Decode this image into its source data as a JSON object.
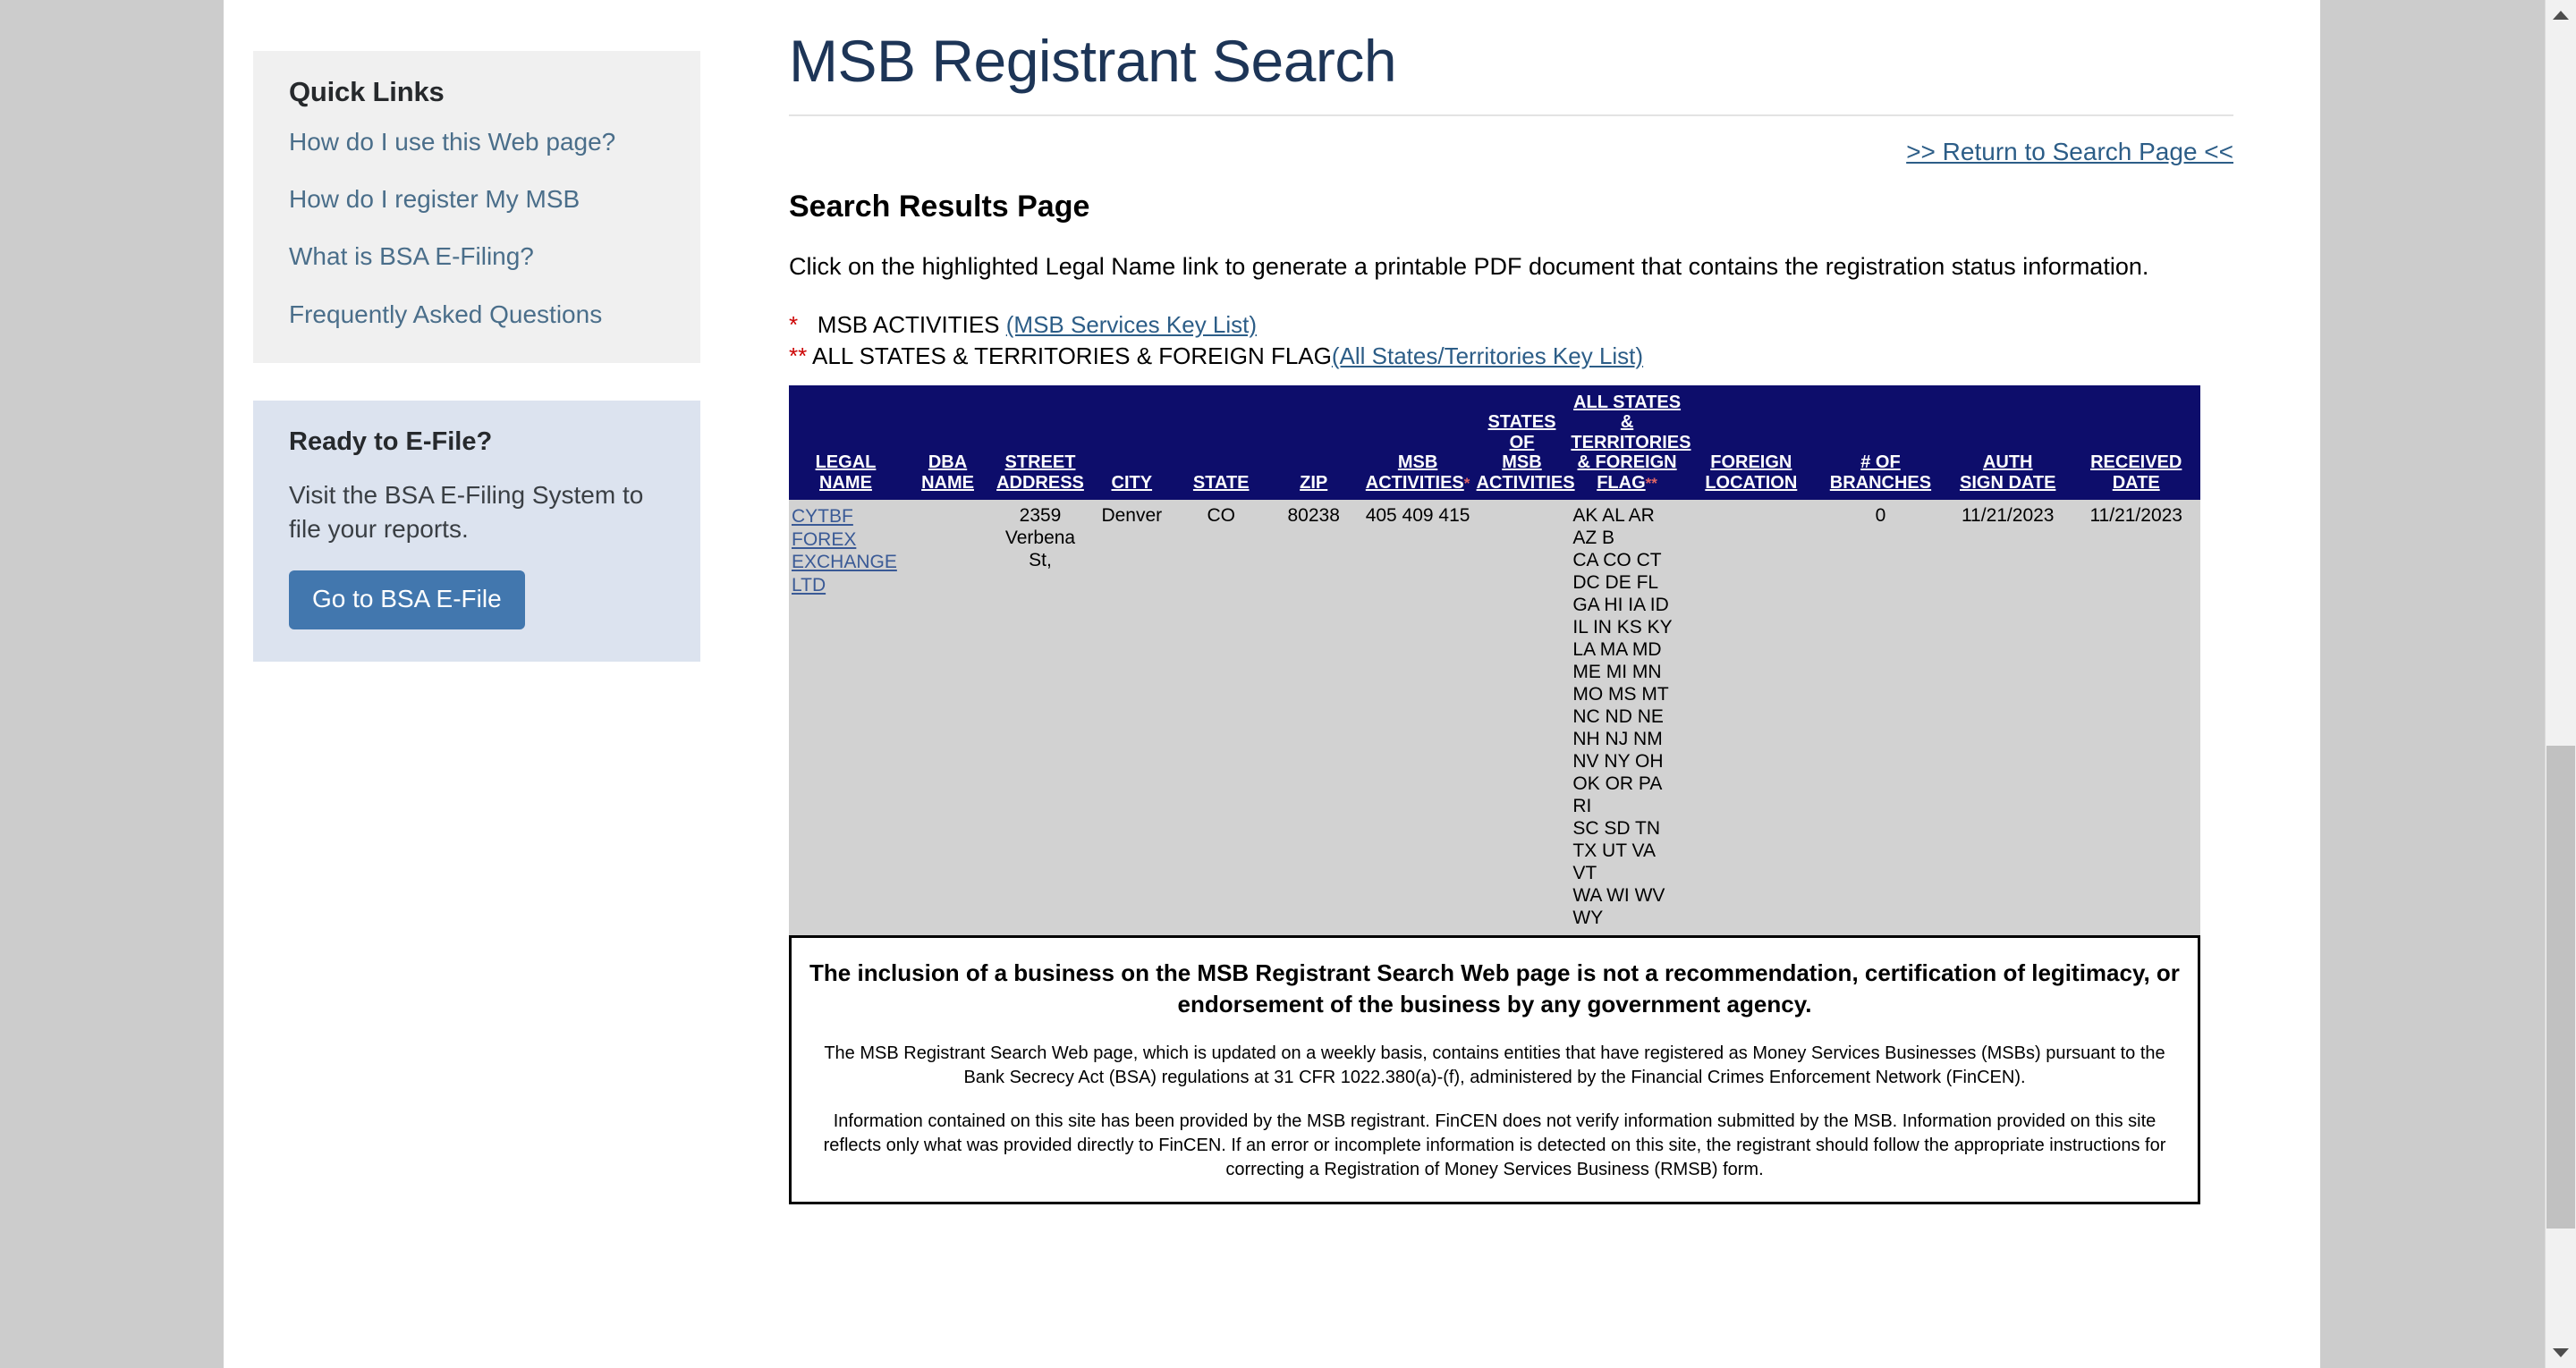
{
  "page": {
    "title": "MSB Registrant Search",
    "return_link": ">> Return to Search Page <<",
    "results_heading": "Search Results Page",
    "click_note": "Click on the highlighted Legal Name link to generate a printable PDF document that contains the registration status information.",
    "legend": {
      "single_star": "*",
      "double_star": "**",
      "msb_activities_label": "MSB ACTIVITIES",
      "msb_activities_link": "(MSB Services Key List)",
      "all_states_label": "ALL STATES & TERRITORIES & FOREIGN FLAG",
      "all_states_link": "(All States/Territories Key List)"
    }
  },
  "sidebar": {
    "quick_links": {
      "title": "Quick Links",
      "items": [
        {
          "label": "How do I use this Web page?"
        },
        {
          "label": "How do I register My MSB"
        },
        {
          "label": "What is BSA E-Filing?"
        },
        {
          "label": "Frequently Asked Questions"
        }
      ]
    },
    "efile": {
      "title": "Ready to E-File?",
      "text": "Visit the BSA E-Filing System to file your reports.",
      "button_label": "Go to BSA E-File"
    }
  },
  "table": {
    "columns": [
      {
        "key": "legal_name",
        "line1": "",
        "line2": "",
        "line3": "LEGAL NAME"
      },
      {
        "key": "dba_name",
        "line1": "",
        "line2": "",
        "line3": "DBA NAME"
      },
      {
        "key": "street",
        "line1": "",
        "line2": "STREET",
        "line3": "ADDRESS"
      },
      {
        "key": "city",
        "line1": "",
        "line2": "",
        "line3": "CITY"
      },
      {
        "key": "state",
        "line1": "",
        "line2": "",
        "line3": "STATE"
      },
      {
        "key": "zip",
        "line1": "",
        "line2": "",
        "line3": "ZIP"
      },
      {
        "key": "msb_act",
        "line1": "",
        "line2": "MSB",
        "line3": "ACTIVITIES",
        "star": "*"
      },
      {
        "key": "states_msb",
        "line1": "",
        "line2": "STATES OF",
        "line2b": "MSB",
        "line3": "ACTIVITIES"
      },
      {
        "key": "all_states",
        "line0": "ALL STATES",
        "line0b": "&",
        "line1": "TERRITORIES",
        "line2": "& FOREIGN",
        "line3": "FLAG",
        "star": "**"
      },
      {
        "key": "foreign_loc",
        "line1": "",
        "line2": "FOREIGN",
        "line3": "LOCATION"
      },
      {
        "key": "branches",
        "line1": "",
        "line2": "# OF",
        "line3": "BRANCHES"
      },
      {
        "key": "auth_sign",
        "line1": "",
        "line2": "AUTH",
        "line3": "SIGN DATE"
      },
      {
        "key": "received",
        "line1": "",
        "line2": "RECEIVED",
        "line3": "DATE"
      }
    ],
    "rows": [
      {
        "legal_name": "CYTBF FOREX EXCHANGE LTD",
        "legal_name_lines": [
          "CYTBF",
          "FOREX",
          "EXCHANGE",
          "LTD"
        ],
        "dba_name": "",
        "street": "2359 Verbena St,",
        "street_lines": [
          "2359",
          "Verbena St,"
        ],
        "city": "Denver",
        "state": "CO",
        "zip": "80238",
        "msb_activities": "405 409 415",
        "states_of_msb_activities": "",
        "all_states_territories_foreign_flag": "AK AL AR AZ B CA CO CT DC DE FL GA HI IA ID IL IN KS KY LA MA MD ME MI MN MO MS MT NC ND NE NH NJ NM NV NY OH OK OR PA RI SC SD TN TX UT VA VT WA WI WV WY",
        "all_states_lines": [
          "AK AL AR AZ B",
          "CA CO CT",
          "DC DE FL",
          "GA HI IA ID",
          "IL IN KS KY",
          "LA MA MD",
          "ME MI MN",
          "MO MS MT",
          "NC ND NE",
          "NH NJ NM",
          "NV NY OH",
          "OK OR PA RI",
          "SC SD TN",
          "TX UT VA VT",
          "WA WI WV",
          "WY"
        ],
        "foreign_location": "",
        "num_branches": "0",
        "auth_sign_date": "11/21/2023",
        "received_date": "11/21/2023"
      }
    ]
  },
  "disclaimer": {
    "heading": "The inclusion of a business on the MSB Registrant Search Web page is not a recommendation, certification of legitimacy, or endorsement of the business by any government agency.",
    "paragraph_1": "The MSB Registrant Search Web page, which is updated on a weekly basis, contains entities that have registered as Money Services Businesses (MSBs) pursuant to the Bank Secrecy Act (BSA) regulations at 31 CFR 1022.380(a)-(f), administered by the Financial Crimes Enforcement Network (FinCEN).",
    "paragraph_2": "Information contained on this site has been provided by the MSB registrant. FinCEN does not verify information submitted by the MSB. Information provided on this site reflects only what was provided directly to FinCEN. If an error or incomplete information is detected on this site, the registrant should follow the appropriate instructions for correcting a Registration of Money Services Business (RMSB) form."
  },
  "colors": {
    "page_background": "#cccccc",
    "table_header": "#0d0d6b",
    "table_row": "#d2d2d2",
    "link": "#2c5d87",
    "title": "#1d3557",
    "button": "#4277ae",
    "asterisk": "#cc0000"
  },
  "scrollbar": {
    "up_arrow": "scroll-up-arrow",
    "down_arrow": "scroll-down-arrow"
  }
}
